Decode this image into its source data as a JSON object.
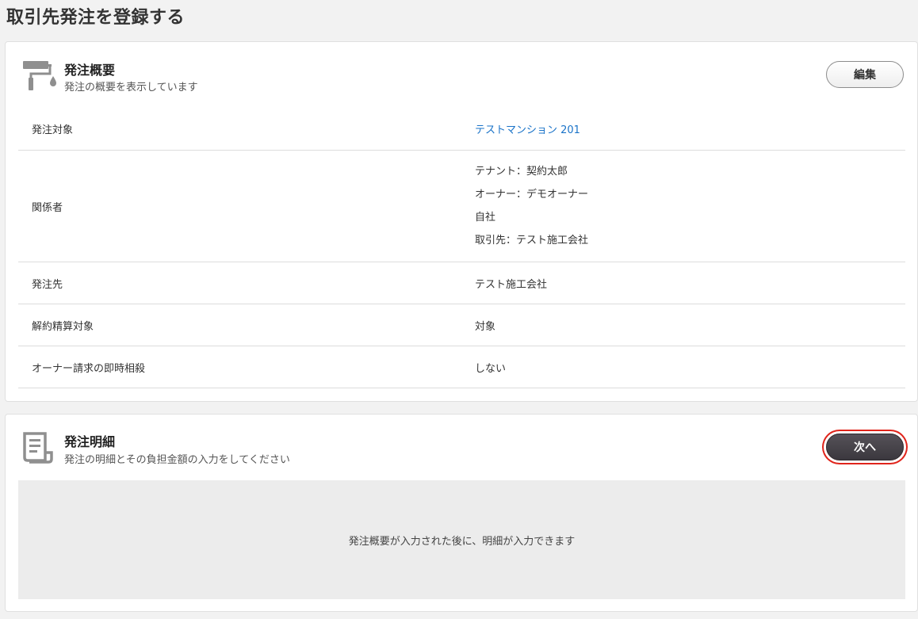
{
  "page": {
    "title": "取引先発注を登録する"
  },
  "summary": {
    "title": "発注概要",
    "subtitle": "発注の概要を表示しています",
    "icon": "paint-roller-icon",
    "edit_label": "編集",
    "rows": [
      {
        "label": "発注対象",
        "value": "テストマンション 201"
      },
      {
        "label": "関係者",
        "values": [
          "テナント：契約太郎",
          "オーナー：デモオーナー",
          "自社",
          "取引先：テスト施工会社"
        ]
      },
      {
        "label": "発注先",
        "value": "テスト施工会社"
      },
      {
        "label": "解約精算対象",
        "value": "対象"
      },
      {
        "label": "オーナー請求の即時相殺",
        "value": "しない"
      }
    ]
  },
  "details": {
    "title": "発注明細",
    "subtitle": "発注の明細とその負担金額の入力をしてください",
    "icon": "document-icon",
    "next_label": "次へ",
    "notice": "発注概要が入力された後に、明細が入力できます"
  },
  "colors": {
    "link": "#1a73c8",
    "highlight": "#e0241b",
    "primary_button": "#46424a"
  }
}
